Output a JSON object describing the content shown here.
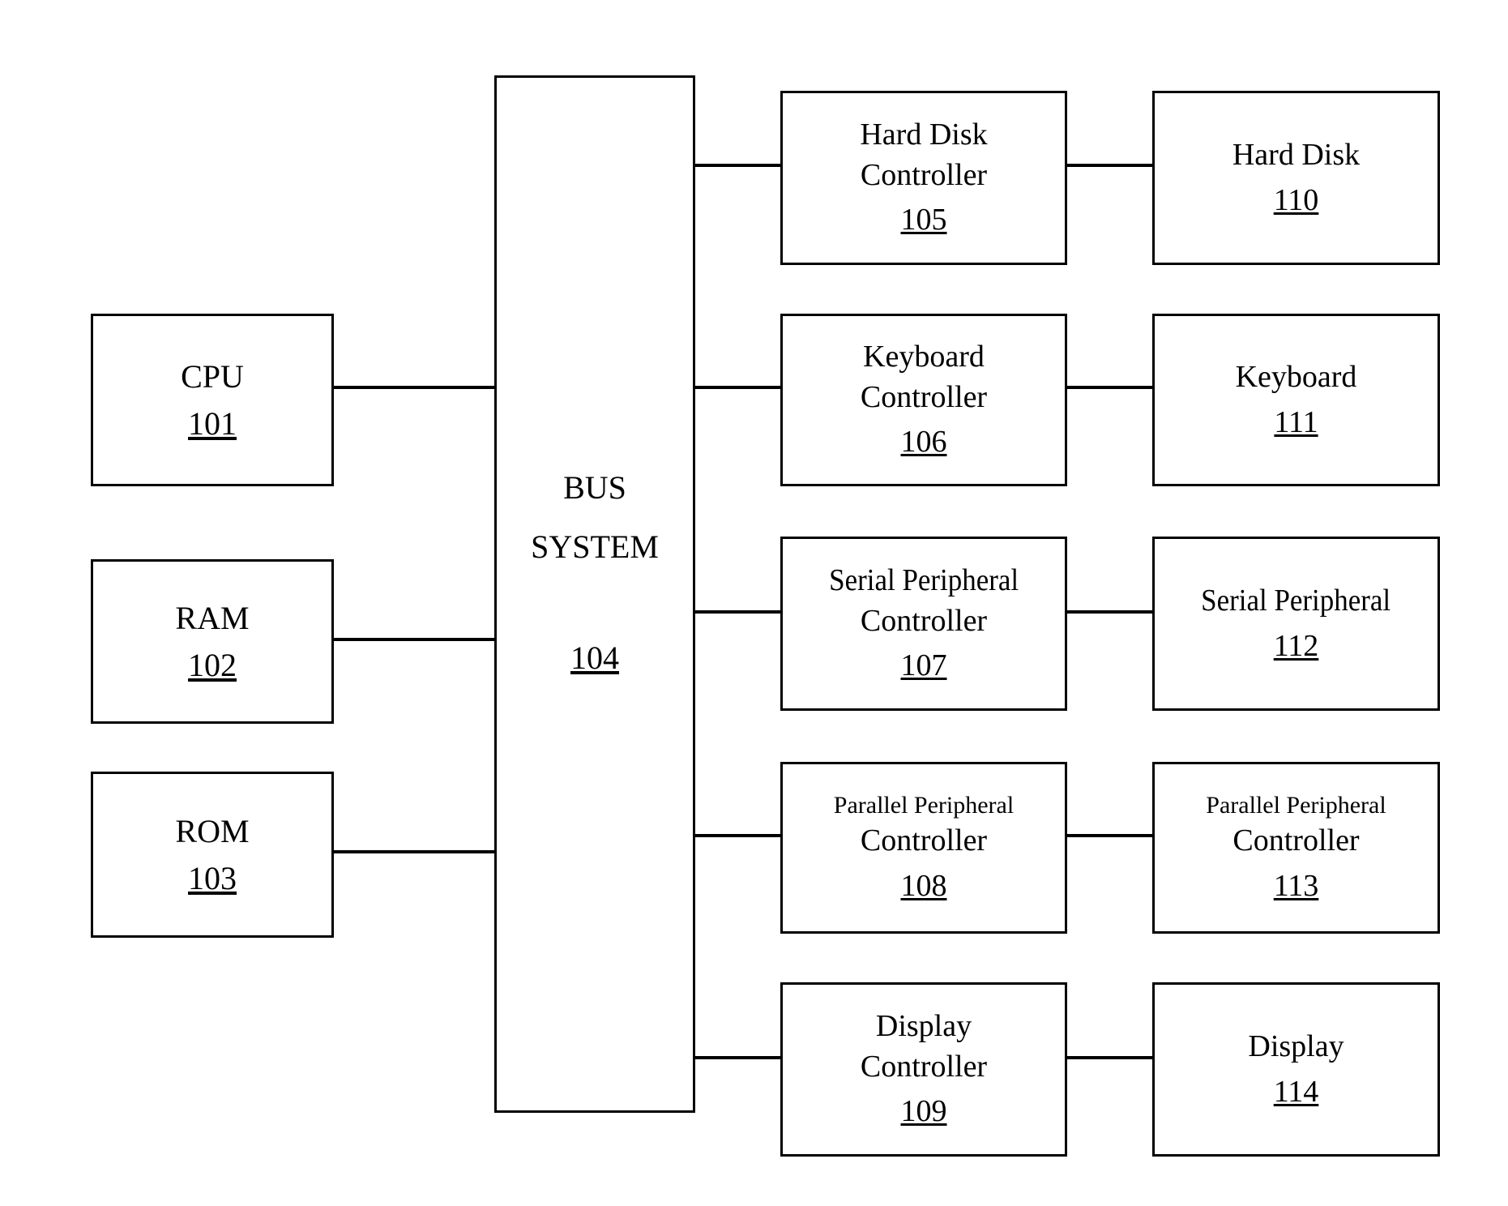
{
  "figure": {
    "kind": "block-diagram",
    "background_color": "#ffffff",
    "line_color": "#000000"
  },
  "bus": {
    "line1": "BUS",
    "line2": "SYSTEM",
    "refnum": "104"
  },
  "left_column": [
    {
      "key": "cpu",
      "line1": "CPU",
      "refnum": "101"
    },
    {
      "key": "ram",
      "line1": "RAM",
      "refnum": "102"
    },
    {
      "key": "rom",
      "line1": "ROM",
      "refnum": "103"
    }
  ],
  "controller_column": [
    {
      "key": "hard-disk-controller",
      "line1": "Hard Disk",
      "line2": "Controller",
      "refnum": "105"
    },
    {
      "key": "keyboard-controller",
      "line1": "Keyboard",
      "line2": "Controller",
      "refnum": "106"
    },
    {
      "key": "serial-peripheral-controller",
      "line1": "Serial Peripheral",
      "line2": "Controller",
      "refnum": "107"
    },
    {
      "key": "parallel-peripheral-controller",
      "line1": "Parallel Peripheral",
      "line2": "Controller",
      "refnum": "108"
    },
    {
      "key": "display-controller",
      "line1": "Display",
      "line2": "Controller",
      "refnum": "109"
    }
  ],
  "device_column": [
    {
      "key": "hard-disk",
      "line1": "Hard Disk",
      "line2": "",
      "refnum": "110"
    },
    {
      "key": "keyboard",
      "line1": "Keyboard",
      "line2": "",
      "refnum": "111"
    },
    {
      "key": "serial-peripheral",
      "line1": "Serial Peripheral",
      "line2": "",
      "refnum": "112"
    },
    {
      "key": "parallel-peripheral",
      "line1": "Parallel Peripheral",
      "line2": "Controller",
      "refnum": "113"
    },
    {
      "key": "display",
      "line1": "Display",
      "line2": "",
      "refnum": "114"
    }
  ]
}
